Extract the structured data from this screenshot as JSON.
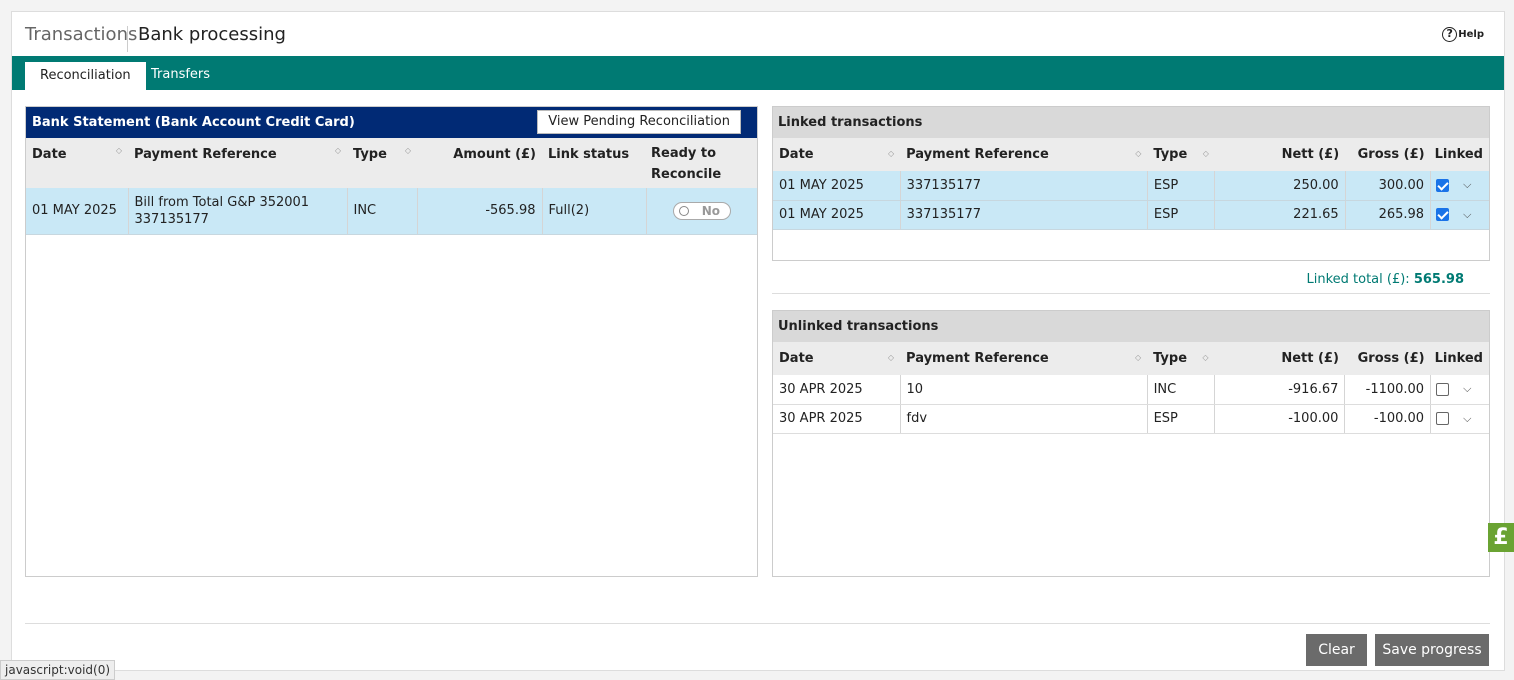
{
  "header": {
    "section": "Transactions",
    "title": "Bank processing",
    "help_label": "Help"
  },
  "tabs": [
    {
      "label": "Reconciliation",
      "active": true
    },
    {
      "label": "Transfers",
      "active": false
    }
  ],
  "bank_statement": {
    "title": "Bank Statement (Bank Account Credit Card)",
    "view_pending_label": "View Pending Reconciliation",
    "columns": [
      "Date",
      "Payment Reference",
      "Type",
      "Amount (£)",
      "Link status",
      "Ready to Reconcile"
    ],
    "rows": [
      {
        "date": "01 MAY 2025",
        "ref": "Bill from Total G&P 352001 337135177",
        "type": "INC",
        "amount": "-565.98",
        "link_status": "Full(2)",
        "ready": "No"
      }
    ]
  },
  "linked": {
    "title": "Linked transactions",
    "columns": [
      "Date",
      "Payment Reference",
      "Type",
      "Nett (£)",
      "Gross (£)",
      "Linked"
    ],
    "rows": [
      {
        "date": "01 MAY 2025",
        "ref": "337135177",
        "type": "ESP",
        "nett": "250.00",
        "gross": "300.00",
        "linked": true
      },
      {
        "date": "01 MAY 2025",
        "ref": "337135177",
        "type": "ESP",
        "nett": "221.65",
        "gross": "265.98",
        "linked": true
      }
    ],
    "total_label": "Linked total (£):",
    "total_value": "565.98"
  },
  "unlinked": {
    "title": "Unlinked transactions",
    "columns": [
      "Date",
      "Payment Reference",
      "Type",
      "Nett (£)",
      "Gross (£)",
      "Linked"
    ],
    "rows": [
      {
        "date": "30 APR 2025",
        "ref": "10",
        "type": "INC",
        "nett": "-916.67",
        "gross": "-1100.00",
        "linked": false
      },
      {
        "date": "30 APR 2025",
        "ref": "fdv",
        "type": "ESP",
        "nett": "-100.00",
        "gross": "-100.00",
        "linked": false
      }
    ]
  },
  "buttons": {
    "clear": "Clear",
    "save": "Save progress"
  },
  "status_bar": "javascript:void(0)",
  "side_tab_symbol": "£",
  "icons": {
    "help": "help-circle-icon",
    "sort": "sort-icon",
    "chevron": "chevron-down-icon"
  },
  "colors": {
    "tabbar": "#007a73",
    "bank_header": "#012a75",
    "selected_row": "#c9e8f6",
    "button": "#6b6b6b",
    "side_tab": "#6aa332"
  }
}
